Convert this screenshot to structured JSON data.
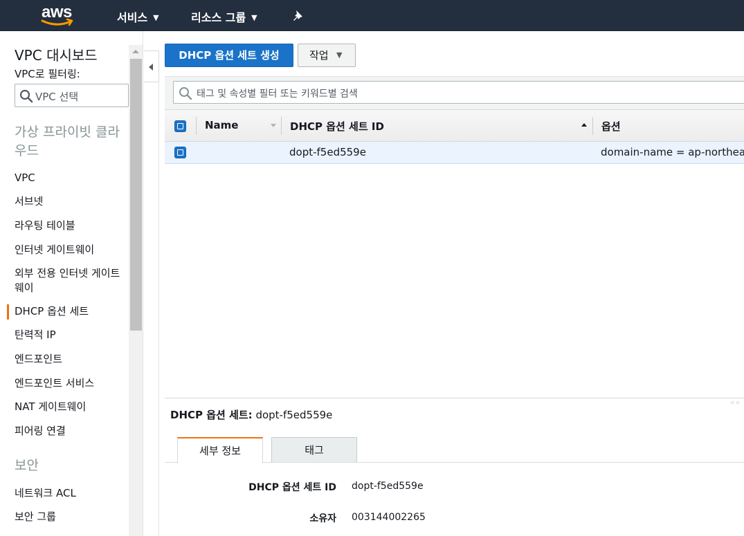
{
  "topnav": {
    "logo_text": "aws",
    "services_label": "서비스",
    "resource_groups_label": "리소스 그룹",
    "icons": {
      "chevron": "chevron-down-icon",
      "pin": "pin-icon"
    },
    "colors": {
      "bar": "#232f3e",
      "smile": "#ff9900"
    }
  },
  "sidebar": {
    "title": "VPC 대시보드",
    "filter_label": "VPC로 필터링:",
    "vpc_select_placeholder": "VPC 선택",
    "section_vpc": "가상 프라이빗 클라우드",
    "items": [
      {
        "label": "VPC"
      },
      {
        "label": "서브넷"
      },
      {
        "label": "라우팅 테이블"
      },
      {
        "label": "인터넷 게이트웨이"
      },
      {
        "label": "외부 전용 인터넷 게이트웨이"
      },
      {
        "label": "DHCP 옵션 세트",
        "active": true
      },
      {
        "label": "탄력적 IP"
      },
      {
        "label": "엔드포인트"
      },
      {
        "label": "엔드포인트 서비스"
      },
      {
        "label": "NAT 게이트웨이"
      },
      {
        "label": "피어링 연결"
      }
    ],
    "section_security": "보안",
    "security_items": [
      {
        "label": "네트워크 ACL"
      },
      {
        "label": "보안 그룹"
      }
    ],
    "active_color": "#ec7211"
  },
  "toolbar": {
    "create_label": "DHCP 옵션 세트 생성",
    "actions_label": "작업",
    "primary_color": "#1a73c8"
  },
  "filter": {
    "placeholder": "태그 및 속성별 필터 또는 키워드별 검색"
  },
  "table": {
    "columns": [
      "Name",
      "DHCP 옵션 세트 ID",
      "옵션"
    ],
    "rows": [
      {
        "selected": true,
        "name": "",
        "id": "dopt-f5ed559e",
        "options": "domain-name = ap-northeast-"
      }
    ]
  },
  "details": {
    "title_label": "DHCP 옵션 세트:",
    "title_value": "dopt-f5ed559e",
    "tabs": [
      "세부 정보",
      "태그"
    ],
    "fields": [
      {
        "label": "DHCP 옵션 세트 ID",
        "value": "dopt-f5ed559e"
      },
      {
        "label": "소유자",
        "value": "003144002265"
      }
    ]
  }
}
